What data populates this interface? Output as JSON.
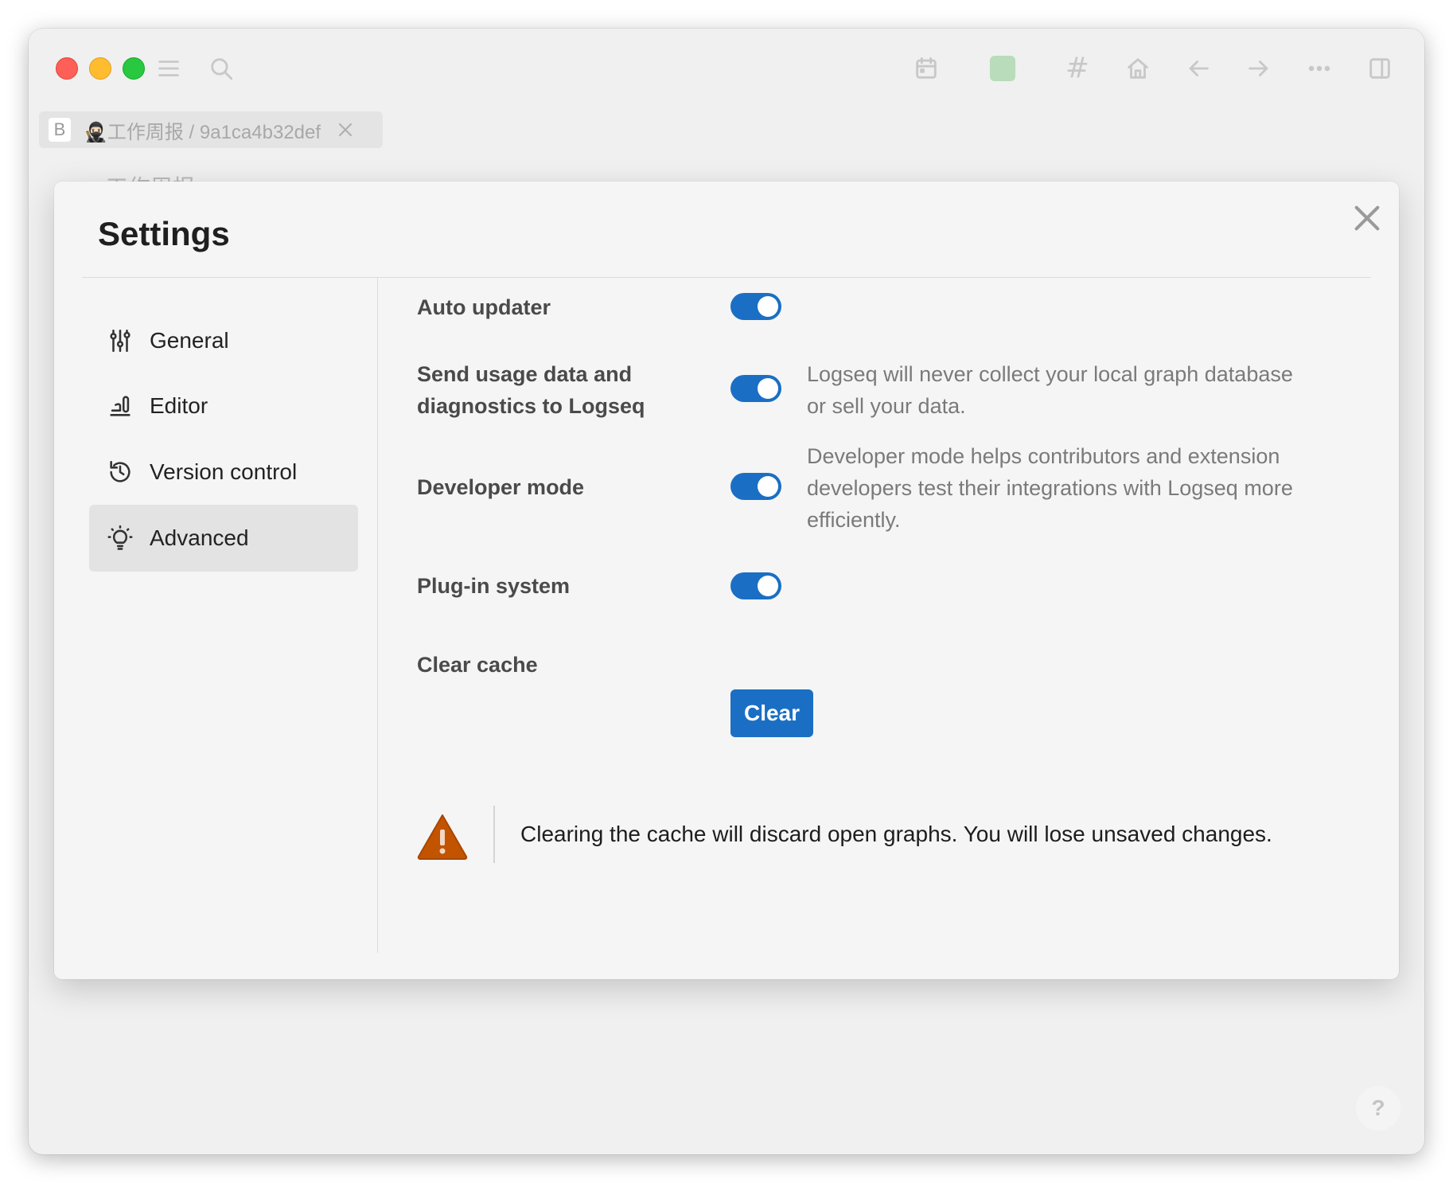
{
  "tab": {
    "badge": "B",
    "label": "🥷🏻工作周报 / 9a1ca4b32def"
  },
  "background_page_title": "● 工作周报",
  "colors": {
    "accent": "#1a6fc4",
    "graph_color": "#b9dcba",
    "warning": "#c25400"
  },
  "toolbar": {
    "icons": [
      "menu-icon",
      "search-icon",
      "calendar-icon",
      "graph-color-square",
      "hash-icon",
      "home-icon",
      "back-arrow-icon",
      "forward-arrow-icon",
      "more-icon",
      "sidebar-toggle-icon"
    ],
    "hash_glyph": "#"
  },
  "settings": {
    "title": "Settings",
    "nav": [
      {
        "label": "General",
        "icon": "sliders-icon"
      },
      {
        "label": "Editor",
        "icon": "editor-icon"
      },
      {
        "label": "Version control",
        "icon": "history-icon"
      },
      {
        "label": "Advanced",
        "icon": "bulb-icon",
        "active": true
      }
    ],
    "rows": {
      "auto_updater": {
        "label": "Auto updater",
        "enabled": true
      },
      "usage_data": {
        "label_line1": "Send usage data and",
        "label_line2": "diagnostics to Logseq",
        "enabled": true,
        "desc_line1": "Logseq will never collect your local graph database",
        "desc_line2": "or sell your data."
      },
      "developer_mode": {
        "label": "Developer mode",
        "enabled": true,
        "desc_line1": "Developer mode helps contributors and extension",
        "desc_line2": "developers test their integrations with Logseq more",
        "desc_line3": "efficiently."
      },
      "plugin_system": {
        "label": "Plug-in system",
        "enabled": true
      },
      "clear_cache": {
        "label": "Clear cache",
        "button": "Clear"
      }
    },
    "warning": "Clearing the cache will discard open graphs. You will lose unsaved changes."
  },
  "help": "?"
}
